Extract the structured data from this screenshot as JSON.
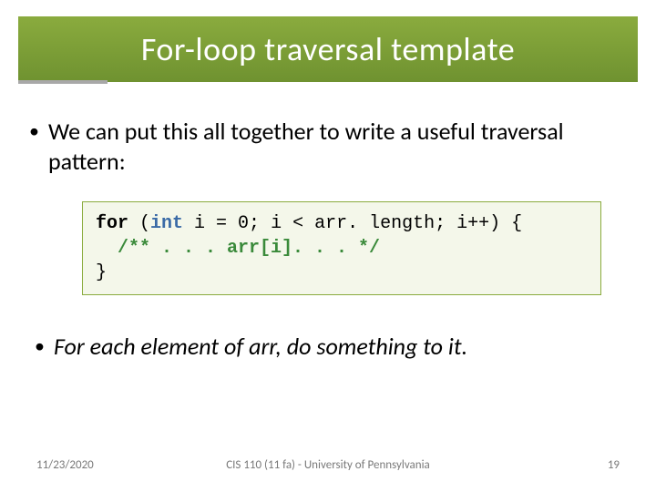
{
  "title": "For-loop traversal template",
  "bullet_intro": "We can put this all together to write a useful traversal pattern:",
  "code": {
    "kw_for": "for",
    "paren_open": " (",
    "ty_int": "int",
    "decl": " i = 0; i < arr. length; i++) {",
    "comment": "  /** . . . arr[i]. . . */",
    "close": "}"
  },
  "bullet_conclusion": "For each element of arr, do something to it.",
  "footer": {
    "date": "11/23/2020",
    "center": "CIS 110 (11 fa) - University of Pennsylvania",
    "page": "19"
  }
}
